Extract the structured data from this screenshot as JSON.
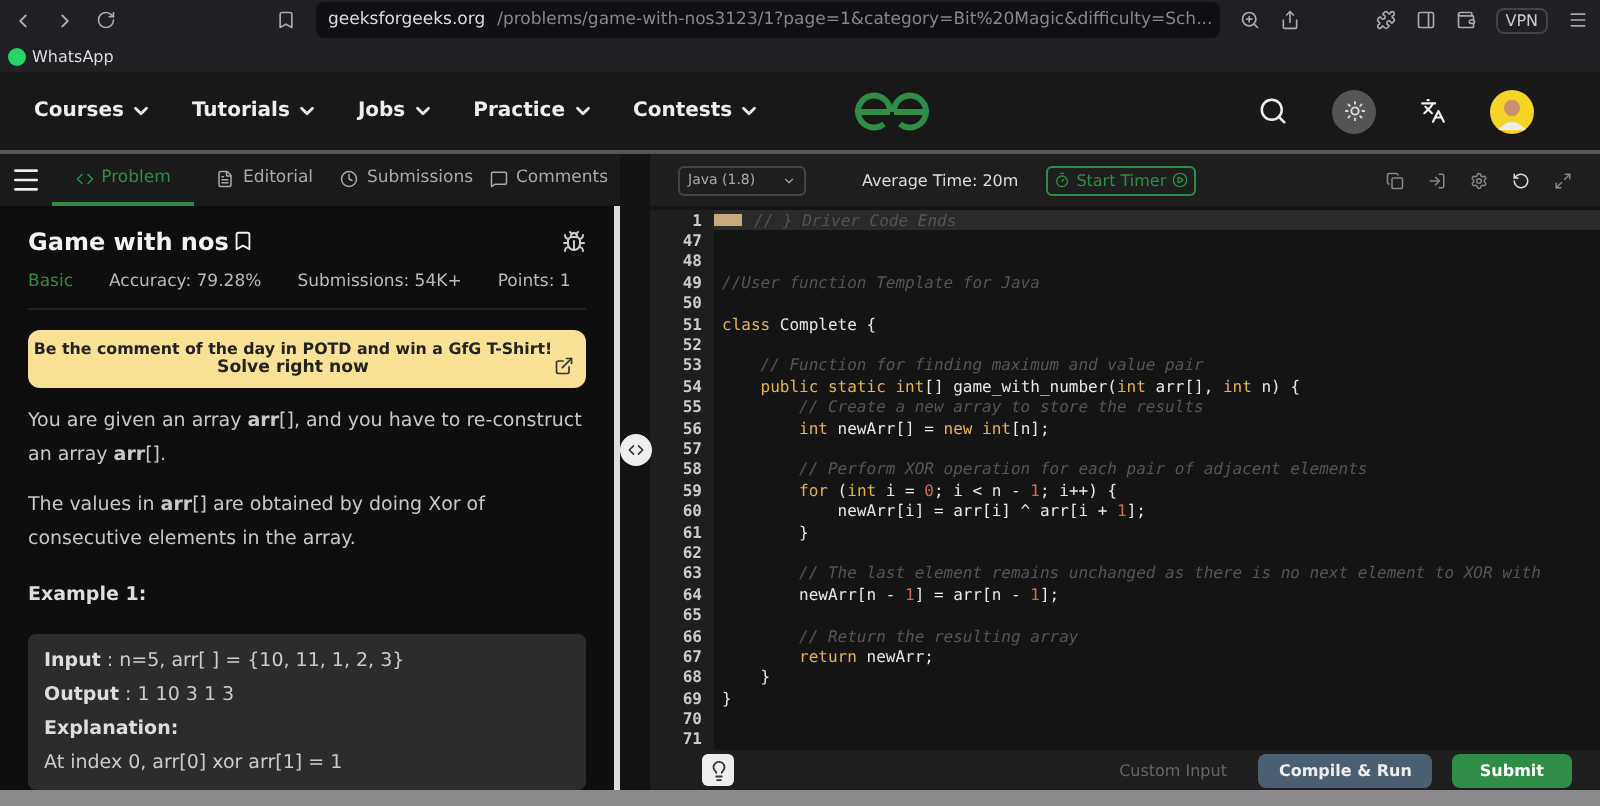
{
  "browser": {
    "url_host": "geeksforgeeks.org",
    "url_path": "/problems/game-with-nos3123/1?page=1&category=Bit%20Magic&difficulty=Sch...",
    "vpn": "VPN",
    "bookmarks": [
      "WhatsApp"
    ]
  },
  "nav": {
    "items": [
      "Courses",
      "Tutorials",
      "Jobs",
      "Practice",
      "Contests"
    ]
  },
  "tabs": [
    {
      "label": "Problem",
      "selected": true
    },
    {
      "label": "Editorial",
      "selected": false
    },
    {
      "label": "Submissions",
      "selected": false
    },
    {
      "label": "Comments",
      "selected": false
    }
  ],
  "problem": {
    "title": "Game with nos",
    "difficulty": "Basic",
    "accuracy": "Accuracy: 79.28%",
    "submissions": "Submissions: 54K+",
    "points": "Points: 1",
    "banner": "Be the comment of the day in POTD and win a GfG T-Shirt!",
    "banner_link": "Solve right now",
    "paragraphs": [
      "You are given an array **arr**[], and you have to re-construct an array **arr**[].",
      "The values in **arr**[] are obtained by doing Xor of consecutive elements in the array."
    ],
    "example_title": "Example 1:",
    "example": [
      {
        "label": "Input",
        "text": " : n=5, arr[ ] = {10, 11, 1, 2, 3}"
      },
      {
        "label": "Output",
        "text": " : 1 10 3 1 3"
      },
      {
        "label": "Explanation:"
      },
      {
        "text": "At index 0, arr[0] xor arr[1] = 1"
      }
    ]
  },
  "editor": {
    "language": "Java (1.8)",
    "average_time": "Average Time: 20m",
    "timer": "Start Timer",
    "lines": [
      {
        "n": "1",
        "fold": true,
        "tokens": [
          {
            "kind": "comment",
            "text": "// } Driver Code Ends"
          }
        ]
      },
      {
        "n": "47"
      },
      {
        "n": "48"
      },
      {
        "n": "49",
        "tokens": [
          {
            "kind": "comment",
            "text": "//User function Template for Java"
          }
        ]
      },
      {
        "n": "50"
      },
      {
        "n": "51",
        "tokens": [
          {
            "kind": "kw",
            "text": "class"
          },
          {
            "kind": "plain",
            "text": " Complete {"
          }
        ]
      },
      {
        "n": "52"
      },
      {
        "n": "53",
        "tokens": [
          {
            "kind": "comment",
            "text": "    // Function for finding maximum and value pair"
          }
        ]
      },
      {
        "n": "54",
        "tokens": [
          {
            "kind": "kw",
            "text": "    public static int"
          },
          {
            "kind": "plain",
            "text": "[] game_with_number("
          },
          {
            "kind": "kw",
            "text": "int"
          },
          {
            "kind": "plain",
            "text": " arr[], "
          },
          {
            "kind": "kw",
            "text": "int"
          },
          {
            "kind": "plain",
            "text": " n) {"
          }
        ]
      },
      {
        "n": "55",
        "tokens": [
          {
            "kind": "comment",
            "text": "        // Create a new array to store the results"
          }
        ]
      },
      {
        "n": "56",
        "tokens": [
          {
            "kind": "kw",
            "text": "        int"
          },
          {
            "kind": "plain",
            "text": " newArr[] = "
          },
          {
            "kind": "kw",
            "text": "new int"
          },
          {
            "kind": "plain",
            "text": "[n];"
          }
        ]
      },
      {
        "n": "57"
      },
      {
        "n": "58",
        "tokens": [
          {
            "kind": "comment",
            "text": "        // Perform XOR operation for each pair of adjacent elements"
          }
        ]
      },
      {
        "n": "59",
        "tokens": [
          {
            "kind": "kw",
            "text": "        for"
          },
          {
            "kind": "plain",
            "text": " ("
          },
          {
            "kind": "kw",
            "text": "int"
          },
          {
            "kind": "plain",
            "text": " i = "
          },
          {
            "kind": "num",
            "text": "0"
          },
          {
            "kind": "plain",
            "text": "; i < n - "
          },
          {
            "kind": "num",
            "text": "1"
          },
          {
            "kind": "plain",
            "text": "; i++) {"
          }
        ]
      },
      {
        "n": "60",
        "tokens": [
          {
            "kind": "plain",
            "text": "            newArr[i] = arr[i] ^ arr[i + "
          },
          {
            "kind": "num",
            "text": "1"
          },
          {
            "kind": "plain",
            "text": "];"
          }
        ]
      },
      {
        "n": "61",
        "tokens": [
          {
            "kind": "plain",
            "text": "        }"
          }
        ]
      },
      {
        "n": "62"
      },
      {
        "n": "63",
        "tokens": [
          {
            "kind": "comment",
            "text": "        // The last element remains unchanged as there is no next element to XOR with"
          }
        ]
      },
      {
        "n": "64",
        "tokens": [
          {
            "kind": "plain",
            "text": "        newArr[n - "
          },
          {
            "kind": "num",
            "text": "1"
          },
          {
            "kind": "plain",
            "text": "] = arr[n - "
          },
          {
            "kind": "num",
            "text": "1"
          },
          {
            "kind": "plain",
            "text": "];"
          }
        ]
      },
      {
        "n": "65"
      },
      {
        "n": "66",
        "tokens": [
          {
            "kind": "comment",
            "text": "        // Return the resulting array"
          }
        ]
      },
      {
        "n": "67",
        "tokens": [
          {
            "kind": "kw",
            "text": "        return"
          },
          {
            "kind": "plain",
            "text": " newArr;"
          }
        ]
      },
      {
        "n": "68",
        "tokens": [
          {
            "kind": "plain",
            "text": "    }"
          }
        ]
      },
      {
        "n": "69",
        "tokens": [
          {
            "kind": "plain",
            "text": "}"
          }
        ]
      },
      {
        "n": "70"
      },
      {
        "n": "71"
      }
    ],
    "custom_input": "Custom Input",
    "compile": "Compile & Run",
    "submit": "Submit"
  }
}
